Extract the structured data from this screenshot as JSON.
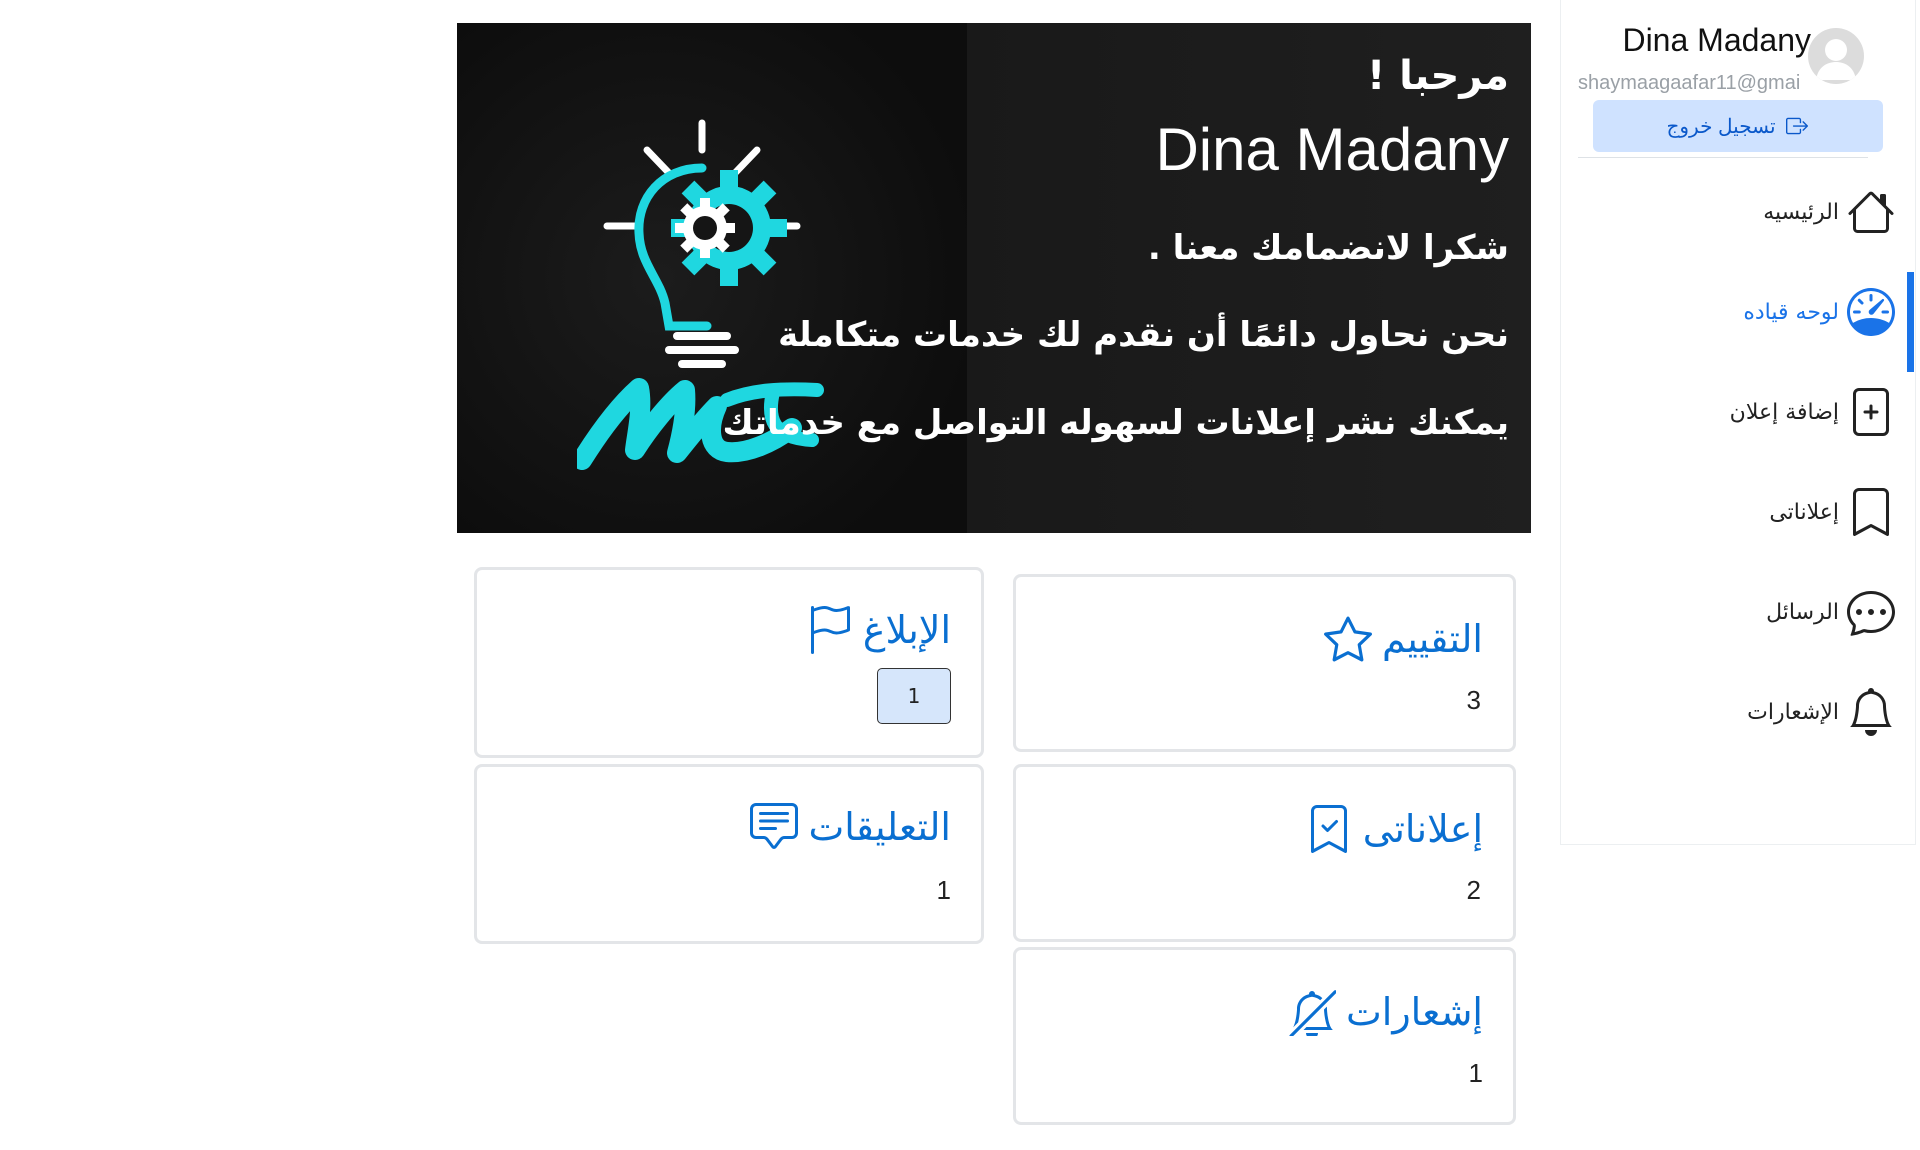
{
  "user": {
    "name": "Dina Madany",
    "email": "shaymaagaafar11@gmai",
    "logout_label": "تسجيل  خروج"
  },
  "nav": {
    "items": [
      {
        "label": "الرئيسيه",
        "icon": "home-icon",
        "active": false
      },
      {
        "label": "لوحه قياده",
        "icon": "speedometer-icon",
        "active": true
      },
      {
        "label": "إضافة إعلان",
        "icon": "file-plus-icon",
        "active": false
      },
      {
        "label": "إعلاناتى",
        "icon": "bookmark-icon",
        "active": false
      },
      {
        "label": "الرسائل",
        "icon": "chat-dots-icon",
        "active": false
      },
      {
        "label": "الإشعارات",
        "icon": "bell-icon",
        "active": false
      }
    ]
  },
  "banner": {
    "greeting": "مرحبا !",
    "name": "Dina Madany",
    "line1": "شكرا لانضمامك معنا .",
    "line2": "نحن نحاول دائمًا أن نقدم لك خدمات متكاملة",
    "line3": "يمكنك نشر إعلانات لسهوله التواصل مع خدماتك",
    "logo_colors": {
      "primary": "#1fd7e0",
      "secondary": "#ffffff"
    }
  },
  "stats": {
    "rating": {
      "title": "التقييم",
      "value": "3",
      "icon": "star-icon"
    },
    "reports": {
      "title": "الإبلاغ",
      "value": "1",
      "icon": "flag-icon"
    },
    "my_ads": {
      "title": "إعلاناتى",
      "value": "2",
      "icon": "bookmark-check-icon"
    },
    "comments": {
      "title": "التعليقات",
      "value": "1",
      "icon": "chat-square-text-icon"
    },
    "notifications": {
      "title": "إشعارات",
      "value": "1",
      "icon": "bell-slash-icon"
    }
  },
  "colors": {
    "accent": "#0a6fd1",
    "active_nav": "#1a73e8",
    "logout_bg": "#cfe2ff"
  }
}
